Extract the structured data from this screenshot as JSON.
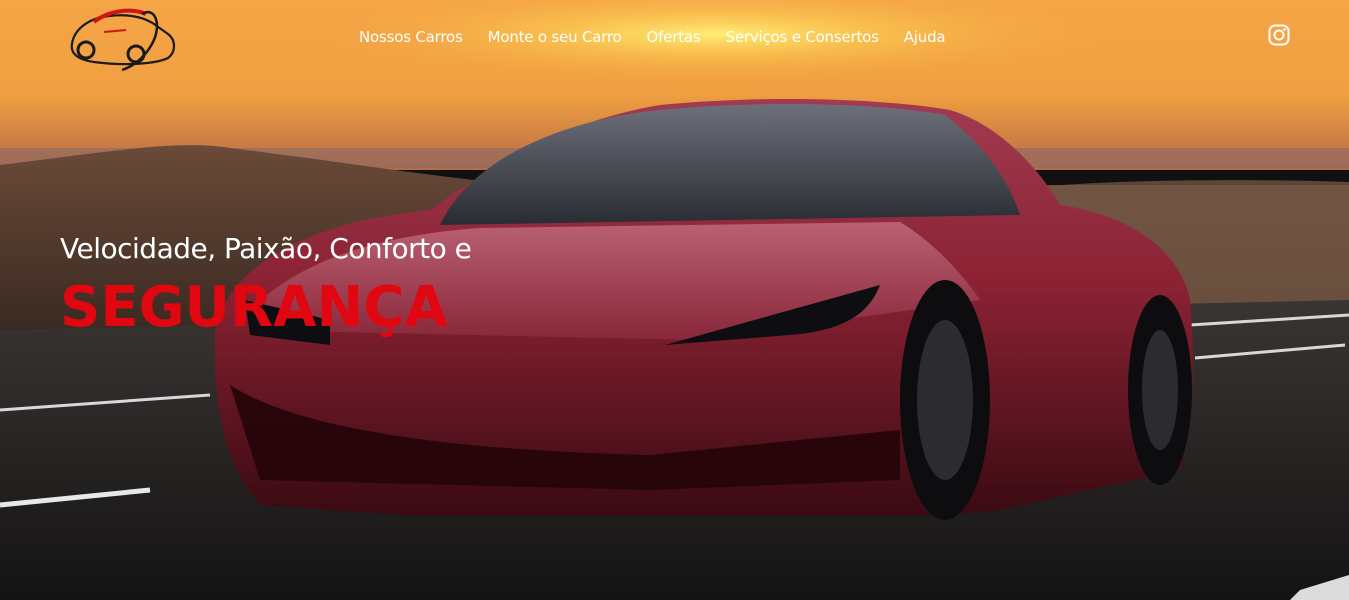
{
  "header": {
    "logo_icon": "car-logo-icon",
    "nav": [
      {
        "label": "Nossos Carros"
      },
      {
        "label": "Monte o seu Carro"
      },
      {
        "label": "Ofertas"
      },
      {
        "label": "Serviços e Consertos"
      },
      {
        "label": "Ajuda"
      }
    ],
    "social_icon": "instagram-icon"
  },
  "hero": {
    "tagline": "Velocidade, Paixão, Conforto e",
    "headline": "SEGURANÇA"
  },
  "colors": {
    "accent": "#e00710",
    "nav_text": "#ffffff"
  }
}
